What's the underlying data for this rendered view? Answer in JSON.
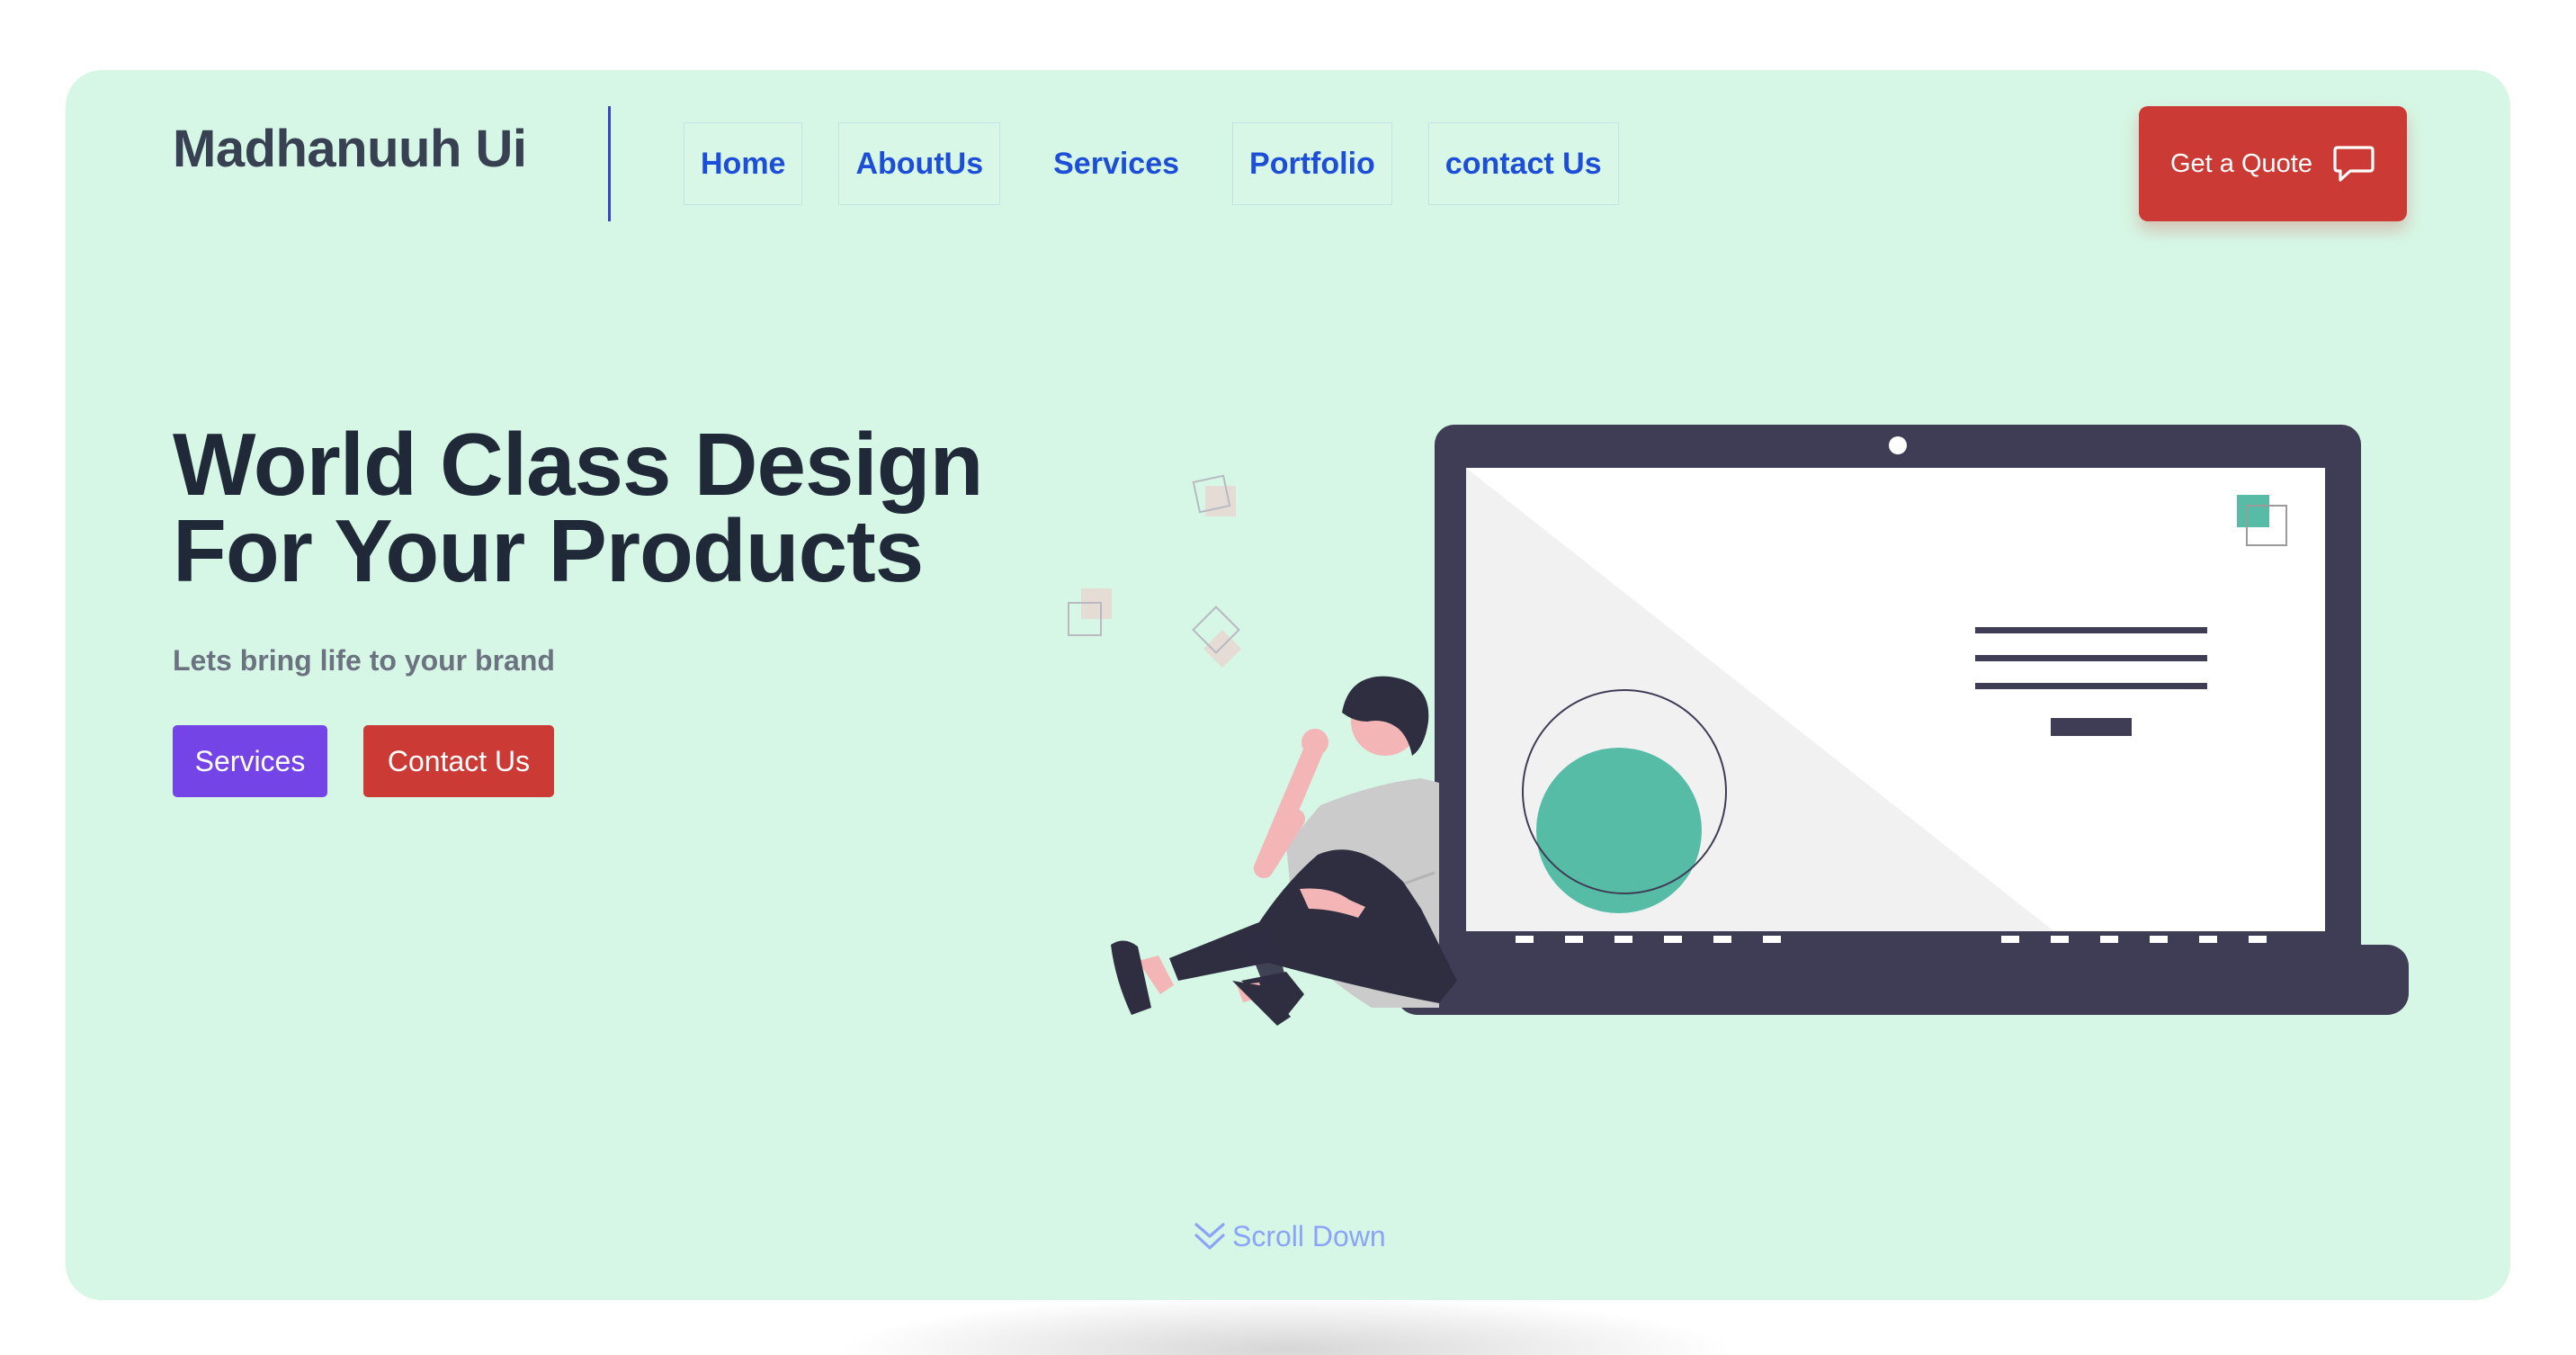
{
  "brand": {
    "name": "Madhanuuh Ui"
  },
  "nav": {
    "items": [
      {
        "label": "Home"
      },
      {
        "label": "AboutUs"
      },
      {
        "label": "Services"
      },
      {
        "label": "Portfolio"
      },
      {
        "label": "contact Us"
      }
    ]
  },
  "header": {
    "quote_label": "Get a Quote",
    "quote_icon": "chat-bubble-icon"
  },
  "hero": {
    "title_line1": "World Class Design",
    "title_line2": "For Your Products",
    "subtitle": "Lets bring life to your brand",
    "primary_button": "Services",
    "secondary_button": "Contact Us"
  },
  "scroll": {
    "label": "Scroll Down",
    "icon": "double-chevron-down-icon"
  },
  "colors": {
    "background": "#d6f7e5",
    "accent_purple": "#7544e6",
    "accent_red": "#cc3a35",
    "nav_blue": "#1d4ed8",
    "laptop": "#3f3d56",
    "teal": "#56bca6"
  }
}
